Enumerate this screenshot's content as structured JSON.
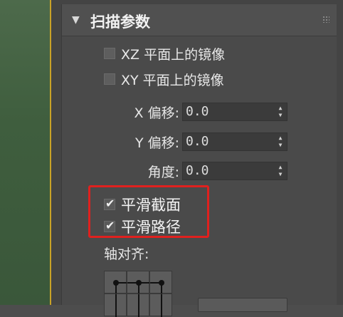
{
  "rollout": {
    "title": "扫描参数"
  },
  "options": {
    "mirror_xz": {
      "label": "XZ 平面上的镜像",
      "checked": false
    },
    "mirror_xy": {
      "label": "XY 平面上的镜像",
      "checked": false
    }
  },
  "fields": {
    "x_offset": {
      "label": "X 偏移:",
      "value": "0.0"
    },
    "y_offset": {
      "label": "Y 偏移:",
      "value": "0.0"
    },
    "angle": {
      "label": "角度:",
      "value": "0.0"
    }
  },
  "smoothing": {
    "section": {
      "label": "平滑截面",
      "checked": true
    },
    "path": {
      "label": "平滑路径",
      "checked": true
    }
  },
  "pivot": {
    "label": "轴对齐:"
  },
  "colors": {
    "highlight": "#e0201e",
    "viewport_border": "#c9a227"
  }
}
